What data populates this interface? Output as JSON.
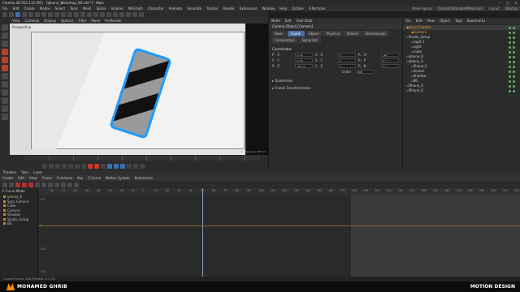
{
  "window": {
    "title": "Cinema 4D R21.115 (RC) - [Iphone_Workshop_06.c4d *] - Main",
    "min": "–",
    "max": "□",
    "close": "✕"
  },
  "menu": [
    "File",
    "Edit",
    "Create",
    "Modes",
    "Select",
    "Tools",
    "Mesh",
    "Spline",
    "Volume",
    "MoGraph",
    "Character",
    "Animate",
    "Simulate",
    "Tracker",
    "Render",
    "Extensions",
    "Window",
    "Help",
    "Octane",
    "X-Particles"
  ],
  "menu_right": {
    "node_space_label": "Node Space:",
    "node_space_value": "Current (Standard/Physical)",
    "layout_label": "Layout:",
    "layout_value": "Startup"
  },
  "viewport": {
    "menu": [
      "View",
      "Cameras",
      "Display",
      "Options",
      "Filter",
      "Panel",
      "ProRender"
    ],
    "label": "Perspective",
    "grid_spacing": "Grid Spacing: 100 cm"
  },
  "attributes": {
    "menu": [
      "Mode",
      "Edit",
      "User Data"
    ],
    "title": "Camera Object [Camera]",
    "tabs": [
      "Basic",
      "Coord.",
      "Object",
      "Physical",
      "Details",
      "Stereoscopic",
      "Composition",
      "Spherical"
    ],
    "active_tab": "Coord.",
    "section": "Coordinates",
    "rows": [
      {
        "p": "P . X",
        "pv": "0 cm",
        "s": "S . X",
        "sv": "1",
        "r": "R . H",
        "rv": "-90 °"
      },
      {
        "p": "P . Y",
        "pv": "0 cm",
        "s": "S . Y",
        "sv": "1",
        "r": "R . P",
        "rv": "0 °"
      },
      {
        "p": "P . Z",
        "pv": "-30 cm",
        "s": "S . Z",
        "sv": "1",
        "r": "R . B",
        "rv": "0 °"
      }
    ],
    "order_label": "Order",
    "order_value": "HPB",
    "subsections": [
      "Quaternion",
      "Freeze Transformation"
    ]
  },
  "objects": {
    "menu": [
      "File",
      "Edit",
      "View",
      "Object",
      "Tags",
      "Bookmarks"
    ],
    "items": [
      {
        "name": "Sync Camera",
        "indent": 0,
        "cam": true
      },
      {
        "name": "Camera",
        "indent": 1,
        "cam": true
      },
      {
        "name": "Studio_Setup",
        "indent": 0,
        "cam": false
      },
      {
        "name": "Light.1",
        "indent": 1,
        "cam": false
      },
      {
        "name": "Light",
        "indent": 1,
        "cam": false
      },
      {
        "name": "Cube",
        "indent": 1,
        "cam": false
      },
      {
        "name": "iphone_6",
        "indent": 0,
        "cam": false
      },
      {
        "name": "iphone_6",
        "indent": 0,
        "cam": false
      },
      {
        "name": "Phone_6",
        "indent": 1,
        "cam": false
      },
      {
        "name": "Screen",
        "indent": 1,
        "cam": false
      },
      {
        "name": "Shadow",
        "indent": 1,
        "cam": false
      },
      {
        "name": "BG",
        "indent": 1,
        "cam": false
      },
      {
        "name": "iPhone_6",
        "indent": 0,
        "cam": false
      },
      {
        "name": "iPhone_6",
        "indent": 0,
        "cam": false
      }
    ]
  },
  "timeline": {
    "header": [
      "Timeline",
      "Take",
      "Layer"
    ],
    "menu": [
      "Create",
      "Edit",
      "View",
      "Frame",
      "Functions",
      "Key",
      "F-Curve",
      "Motion System",
      "Bookmarks"
    ],
    "left_header": "F-Curve Mode",
    "objects": [
      "iphone_6",
      "Sync Camera",
      "Cube",
      "Camera",
      "Shadow",
      "Studio_Setup",
      "BG"
    ],
    "ruler": [
      "-80",
      "-70",
      "-60",
      "-50",
      "-40",
      "-30",
      "-20",
      "-10",
      "0",
      "10",
      "20",
      "30",
      "40",
      "50",
      "60",
      "70",
      "80",
      "90",
      "100",
      "110",
      "120",
      "130",
      "140",
      "150",
      "160",
      "170",
      "180",
      "190",
      "200",
      "210",
      "220",
      "230",
      "240",
      "250",
      "260",
      "270",
      "280",
      "290",
      "300",
      "310",
      "320"
    ],
    "axis": [
      "100",
      "0",
      "-100",
      "-200"
    ],
    "status": "Current Frame: 186  Preview: 0->150"
  },
  "footer": {
    "name": "MOHAMED GHRIB",
    "brand": "MOTION DESIGN"
  },
  "colors": {
    "accent": "#3f6fb0",
    "camera": "#e8a23a",
    "phone_edge": "#1e9bff"
  }
}
